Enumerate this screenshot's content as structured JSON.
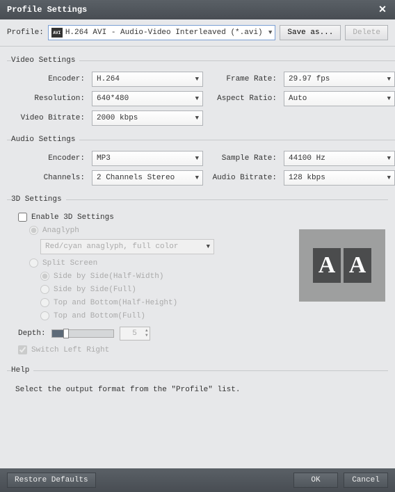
{
  "window": {
    "title": "Profile Settings"
  },
  "toolbar": {
    "profile_label": "Profile:",
    "profile_icon_text": "AVI",
    "selected_profile": "H.264 AVI - Audio-Video Interleaved (*.avi)",
    "save_as_label": "Save as...",
    "delete_label": "Delete"
  },
  "video": {
    "legend": "Video Settings",
    "encoder_label": "Encoder:",
    "encoder_value": "H.264",
    "resolution_label": "Resolution:",
    "resolution_value": "640*480",
    "bitrate_label": "Video Bitrate:",
    "bitrate_value": "2000 kbps",
    "framerate_label": "Frame Rate:",
    "framerate_value": "29.97 fps",
    "aspect_label": "Aspect Ratio:",
    "aspect_value": "Auto"
  },
  "audio": {
    "legend": "Audio Settings",
    "encoder_label": "Encoder:",
    "encoder_value": "MP3",
    "channels_label": "Channels:",
    "channels_value": "2 Channels Stereo",
    "samplerate_label": "Sample Rate:",
    "samplerate_value": "44100 Hz",
    "bitrate_label": "Audio Bitrate:",
    "bitrate_value": "128 kbps"
  },
  "three_d": {
    "legend": "3D Settings",
    "enable_label": "Enable 3D Settings",
    "anaglyph_label": "Anaglyph",
    "anaglyph_mode": "Red/cyan anaglyph, full color",
    "split_label": "Split Screen",
    "split_options": {
      "sbs_half": "Side by Side(Half-Width)",
      "sbs_full": "Side by Side(Full)",
      "tab_half": "Top and Bottom(Half-Height)",
      "tab_full": "Top and Bottom(Full)"
    },
    "depth_label": "Depth:",
    "depth_value": "5",
    "switch_label": "Switch Left Right"
  },
  "help": {
    "legend": "Help",
    "text": "Select the output format from the \"Profile\" list."
  },
  "footer": {
    "restore_label": "Restore Defaults",
    "ok_label": "OK",
    "cancel_label": "Cancel"
  }
}
